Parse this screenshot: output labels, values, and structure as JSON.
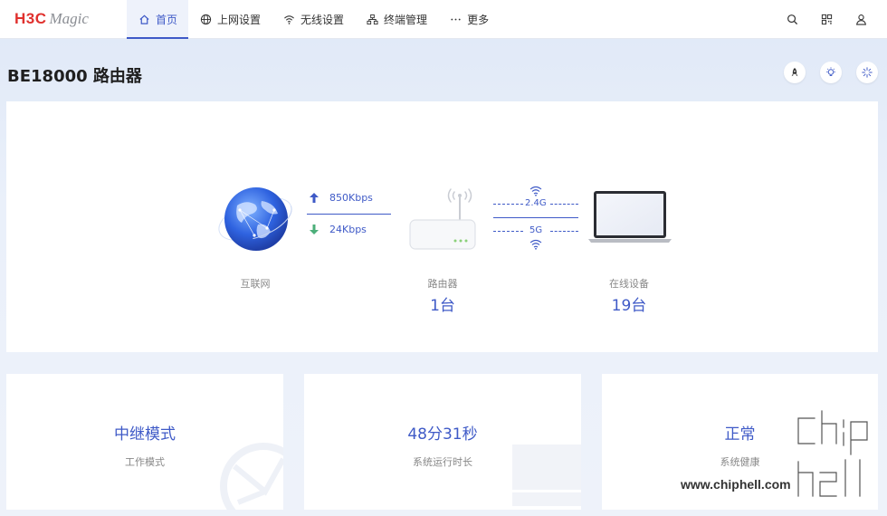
{
  "logo": {
    "brand": "H3C",
    "product": "Magic"
  },
  "nav": [
    {
      "label": "首页",
      "icon": "home-icon",
      "active": true
    },
    {
      "label": "上网设置",
      "icon": "globe-icon"
    },
    {
      "label": "无线设置",
      "icon": "wifi-icon"
    },
    {
      "label": "终端管理",
      "icon": "network-icon"
    },
    {
      "label": "更多",
      "icon": "more-icon"
    }
  ],
  "top_icons": [
    "search-icon",
    "qrcode-icon",
    "user-icon"
  ],
  "page": {
    "title": "BE18000 路由器"
  },
  "title_actions": [
    "rocket-icon",
    "lightbulb-icon",
    "loading-icon"
  ],
  "topology": {
    "internet": {
      "label": "互联网"
    },
    "upload": "850Kbps",
    "download": "24Kbps",
    "router": {
      "label": "路由器",
      "count": "1台"
    },
    "bands": {
      "b24": "2.4G",
      "b5": "5G"
    },
    "devices": {
      "label": "在线设备",
      "count": "19台"
    }
  },
  "stats": [
    {
      "value": "中继模式",
      "label": "工作模式"
    },
    {
      "value": "48分31秒",
      "label": "系统运行时长"
    },
    {
      "value": "正常",
      "label": "系统健康"
    }
  ],
  "watermark": {
    "text": "www.chiphell.com"
  },
  "colors": {
    "accent": "#3f5ac7",
    "brand_red": "#e0312e"
  }
}
